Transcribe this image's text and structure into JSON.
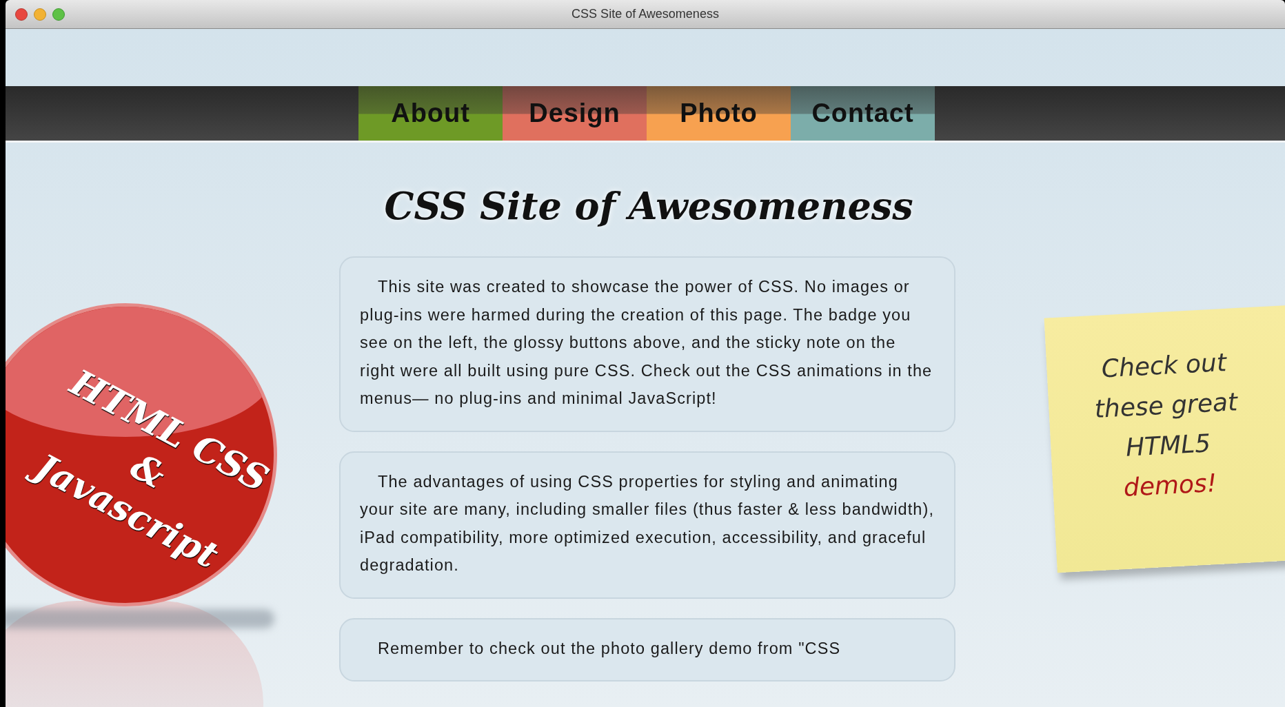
{
  "window": {
    "title": "CSS Site of Awesomeness"
  },
  "nav": [
    {
      "label": "About",
      "color": "#6e9a26"
    },
    {
      "label": "Design",
      "color": "#e0705e"
    },
    {
      "label": "Photo",
      "color": "#f7a150"
    },
    {
      "label": "Contact",
      "color": "#7cadaa"
    }
  ],
  "heading": "CSS Site of Awesomeness",
  "paragraphs": [
    "This site was created to showcase the power of CSS. No images or plug-ins were harmed during the creation of this page. The badge you see on the left, the glossy buttons above, and the sticky note on the right were all built using pure CSS. Check out the CSS animations in the menus— no plug-ins and minimal JavaScript!",
    "The advantages of using CSS properties for styling and animating your site are many, including smaller files (thus faster & less bandwidth), iPad compatibility, more optimized execution, accessibility, and graceful degradation.",
    "Remember to check out the photo gallery demo from \"CSS"
  ],
  "badge": {
    "lines": [
      "HTML CSS",
      "&",
      "Javascript"
    ]
  },
  "sticky_note": {
    "lines": [
      {
        "text": "Check out",
        "color": "#333333"
      },
      {
        "text": "these great",
        "color": "#333333"
      },
      {
        "text": "HTML5",
        "color": "#333333"
      },
      {
        "text": "demos!",
        "color": "#b01818"
      }
    ]
  }
}
